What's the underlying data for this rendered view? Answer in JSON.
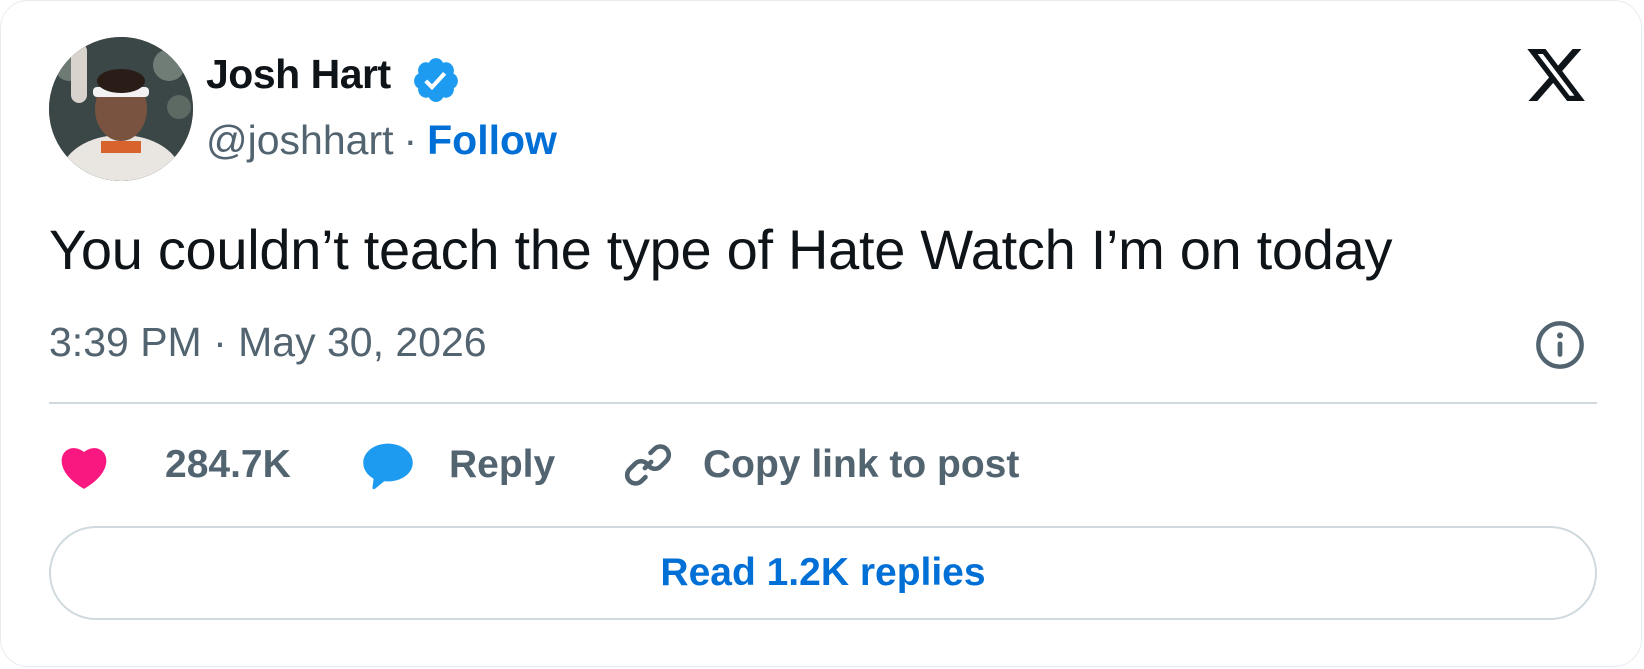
{
  "author": {
    "display_name": "Josh Hart",
    "handle": "@joshhart",
    "separator": "·",
    "follow_label": "Follow",
    "verified_badge_color": "#1d9bf0"
  },
  "tweet": {
    "text": "You couldn’t teach the type of Hate Watch I’m on today",
    "timestamp": "3:39 PM · May 30, 2026"
  },
  "actions": {
    "like_count": "284.7K",
    "like_icon_color": "#f91880",
    "reply_label": "Reply",
    "reply_icon_color": "#1d9bf0",
    "copy_link_label": "Copy link to post"
  },
  "read_replies_label": "Read 1.2K replies",
  "icons": {
    "brand": "x-logo-icon",
    "info": "info-icon",
    "like": "heart-icon",
    "reply": "speech-bubble-icon",
    "copy": "link-icon",
    "verified": "verified-badge-icon"
  },
  "colors": {
    "text_primary": "#0f1419",
    "text_secondary": "#536471",
    "link": "#006fd6",
    "border": "#cfd9de"
  }
}
